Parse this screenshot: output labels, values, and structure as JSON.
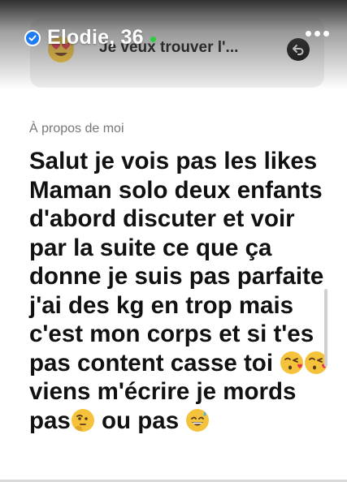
{
  "header": {
    "name": "Elodie, 36",
    "verified": true,
    "online": true,
    "online_color": "#2ecc40",
    "verified_color": "#1e7bf2",
    "more_icon": "more-dots-icon"
  },
  "prompt": {
    "emoji": "heart-eyes-emoji",
    "text": "Je veux trouver l'...",
    "action_icon": "undo-icon"
  },
  "about": {
    "label": "À propos de moi",
    "segments": [
      "Salut je vois pas les likes Maman solo deux enfants d'abord discuter et voir par la suite ce que ça donne je suis pas parfaite j'ai des kg en trop mais c'est mon corps et si t'es pas content casse toi ",
      " viens m'écrire je mords pas",
      " ou pas "
    ],
    "emojis": [
      "kissing-heart-emoji",
      "kissing-heart-emoji",
      "thinking-emoji",
      "sweat-smile-emoji"
    ]
  }
}
